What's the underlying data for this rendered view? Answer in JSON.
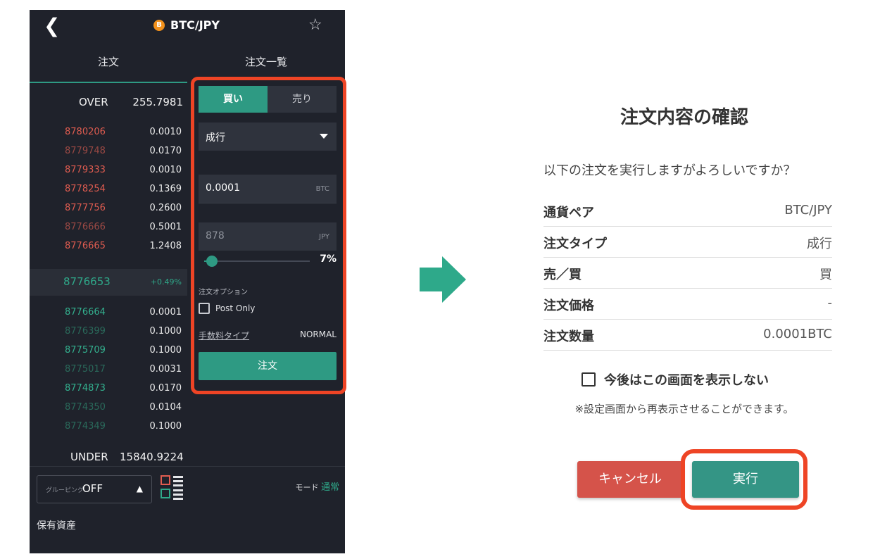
{
  "phone": {
    "header": {
      "coin_badge": "B",
      "pair": "BTC/JPY",
      "back_icon": "chevron-left-icon",
      "star_icon": "star-outline-icon"
    },
    "tabs": [
      {
        "label": "注文"
      },
      {
        "label": "注文一覧"
      }
    ],
    "orderbook": {
      "over_label": "OVER",
      "over_value": "255.7981",
      "asks": [
        {
          "price": "8780206",
          "qty": "0.0010"
        },
        {
          "price": "8779748",
          "qty": "0.0170"
        },
        {
          "price": "8779333",
          "qty": "0.0010"
        },
        {
          "price": "8778254",
          "qty": "0.1369"
        },
        {
          "price": "8777756",
          "qty": "0.2600"
        },
        {
          "price": "8776666",
          "qty": "0.5001"
        },
        {
          "price": "8776665",
          "qty": "1.2408"
        }
      ],
      "mid_price": "8776653",
      "mid_change": "+0.49%",
      "bids": [
        {
          "price": "8776664",
          "qty": "0.0001"
        },
        {
          "price": "8776399",
          "qty": "0.1000"
        },
        {
          "price": "8775709",
          "qty": "0.1000"
        },
        {
          "price": "8775017",
          "qty": "0.0031"
        },
        {
          "price": "8774873",
          "qty": "0.0170"
        },
        {
          "price": "8774350",
          "qty": "0.0104"
        },
        {
          "price": "8774349",
          "qty": "0.1000"
        }
      ],
      "under_label": "UNDER",
      "under_value": "15840.9224"
    },
    "form": {
      "buy_label": "買い",
      "sell_label": "売り",
      "order_type": "成行",
      "amount": "0.0001",
      "amount_unit": "BTC",
      "price": "878",
      "price_unit": "JPY",
      "slider_pct_label": "7%",
      "slider_fraction": 0.07,
      "options_label": "注文オプション",
      "post_only_label": "Post Only",
      "fee_type_label": "手数料タイプ",
      "fee_type_value": "NORMAL",
      "submit_label": "注文"
    },
    "bottom": {
      "grouping_label": "グルーピング",
      "grouping_value": "OFF",
      "mode_label": "モード",
      "mode_value": "通常",
      "assets_label": "保有資産"
    }
  },
  "dialog": {
    "title": "注文内容の確認",
    "message": "以下の注文を実行しますがよろしいですか？",
    "rows": [
      {
        "key": "通貨ペア",
        "value": "BTC/JPY"
      },
      {
        "key": "注文タイプ",
        "value": "成行"
      },
      {
        "key": "売／買",
        "value": "買"
      },
      {
        "key": "注文価格",
        "value": "-"
      },
      {
        "key": "注文数量",
        "value": "0.0001BTC"
      }
    ],
    "dont_show_label": "今後はこの画面を表示しない",
    "note": "※設定画面から再表示させることができます。",
    "cancel_label": "キャンセル",
    "execute_label": "実行"
  },
  "colors": {
    "accent_green": "#2e9a83",
    "ask_red": "#e05c50",
    "highlight_red": "#ee4425",
    "cancel_red": "#d5534a",
    "phone_bg": "#1f222b"
  }
}
